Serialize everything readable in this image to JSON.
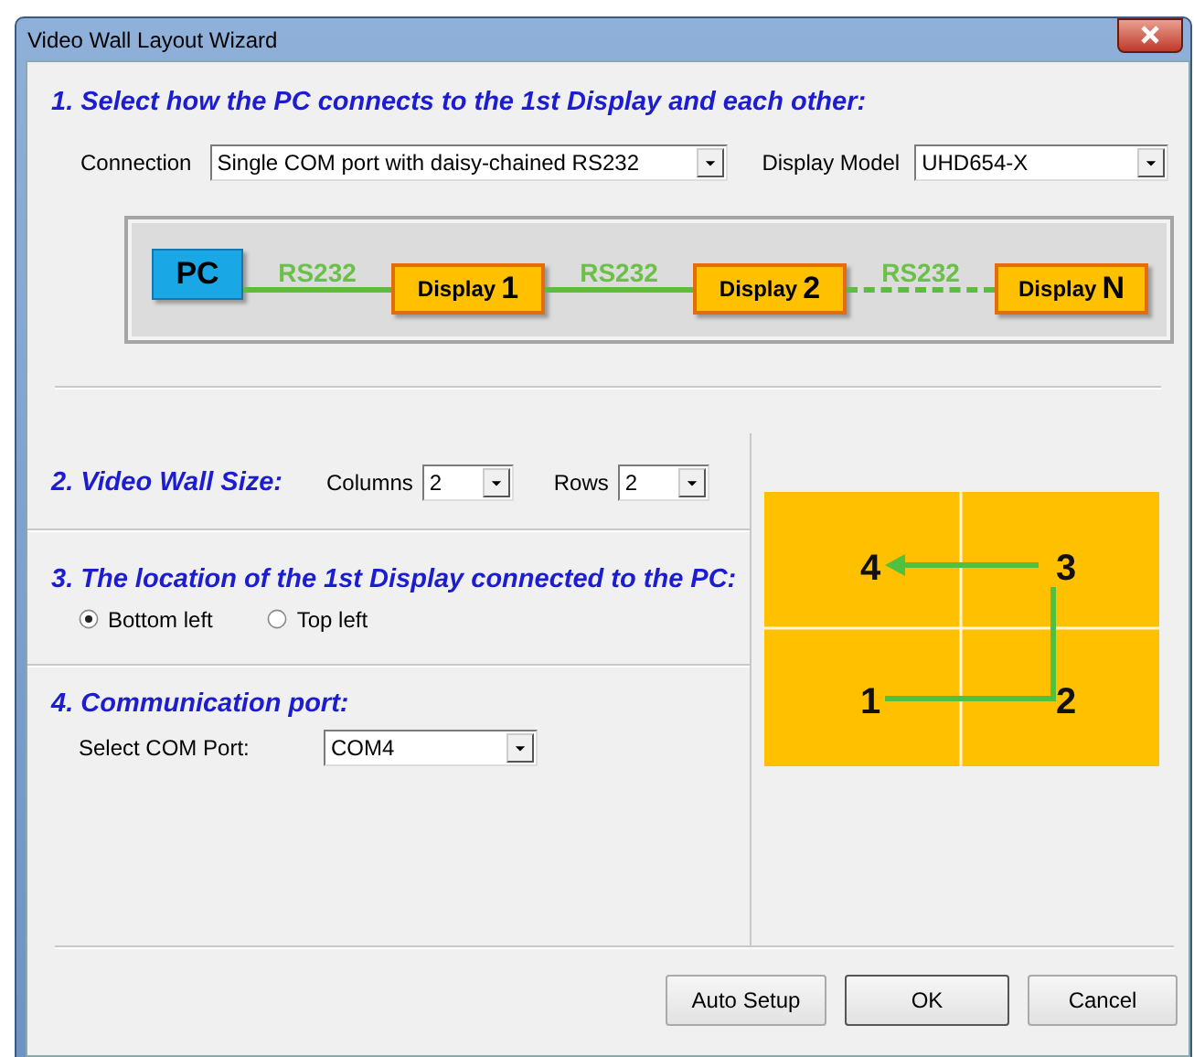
{
  "window": {
    "title": "Video Wall Layout Wizard"
  },
  "step1": {
    "heading": "1. Select how the PC connects to the 1st Display and each other:",
    "connection": {
      "label": "Connection",
      "value": "Single COM port with daisy-chained RS232"
    },
    "display_model": {
      "label": "Display Model",
      "value": "UHD654-X"
    },
    "diagram": {
      "nodes": [
        {
          "kind": "pc",
          "label": "PC"
        },
        {
          "kind": "display",
          "label": "Display",
          "number": "1"
        },
        {
          "kind": "display",
          "label": "Display",
          "number": "2"
        },
        {
          "kind": "display",
          "label": "Display",
          "number": "N"
        }
      ],
      "links": [
        {
          "kind": "solid",
          "label": "RS232"
        },
        {
          "kind": "solid",
          "label": "RS232"
        },
        {
          "kind": "dashed",
          "label": "RS232"
        }
      ]
    }
  },
  "step2": {
    "heading": "2. Video Wall Size:",
    "columns": {
      "label": "Columns",
      "value": "2"
    },
    "rows": {
      "label": "Rows",
      "value": "2"
    }
  },
  "step3": {
    "heading": "3. The location of the 1st Display connected to the PC:",
    "options": [
      {
        "label": "Bottom left",
        "selected": true
      },
      {
        "label": "Top left",
        "selected": false
      }
    ]
  },
  "step4": {
    "heading": "4. Communication port:",
    "port": {
      "label": "Select COM Port:",
      "value": "COM4"
    }
  },
  "wall_preview": {
    "cells": [
      "4",
      "3",
      "1",
      "2"
    ]
  },
  "buttons": [
    {
      "label": "Auto Setup",
      "default": false
    },
    {
      "label": "OK",
      "default": true
    },
    {
      "label": "Cancel",
      "default": false
    }
  ]
}
